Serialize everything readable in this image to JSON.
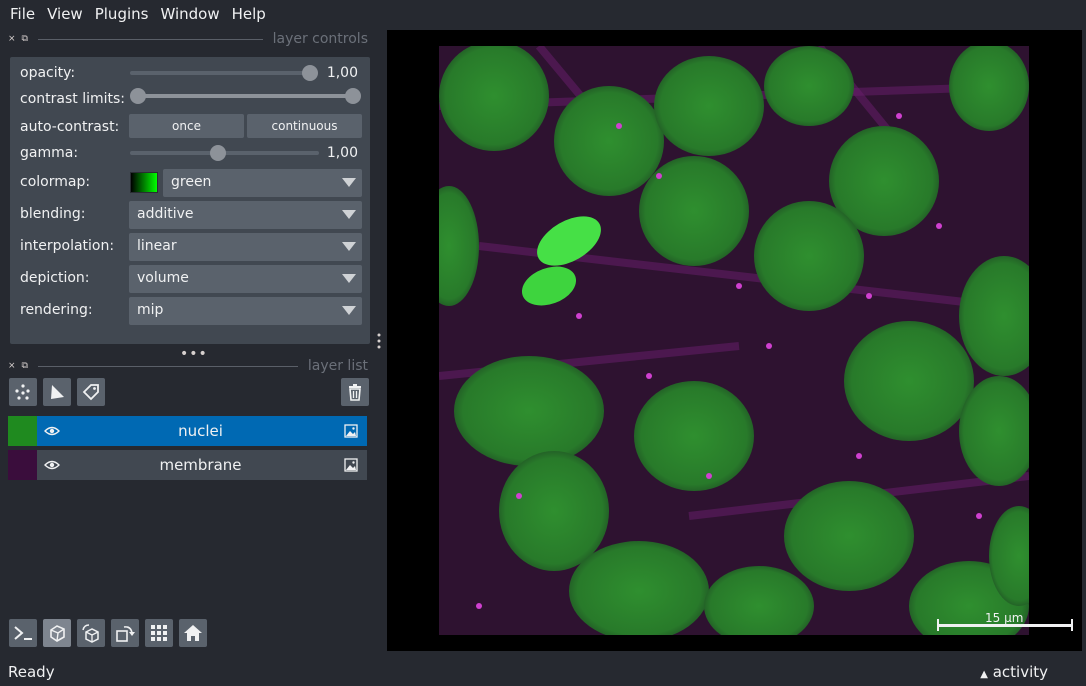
{
  "menu": [
    "File",
    "View",
    "Plugins",
    "Window",
    "Help"
  ],
  "layer_controls": {
    "title": "layer controls",
    "opacity": {
      "label": "opacity:",
      "value": "1,00",
      "level": 1.0
    },
    "contrast": {
      "label": "contrast limits:",
      "low": 0.0,
      "high": 1.0
    },
    "auto_contrast": {
      "label": "auto-contrast:",
      "once": "once",
      "continuous": "continuous"
    },
    "gamma": {
      "label": "gamma:",
      "value": "1,00",
      "level": 0.44
    },
    "colormap": {
      "label": "colormap:",
      "value": "green"
    },
    "blending": {
      "label": "blending:",
      "value": "additive"
    },
    "interpolation": {
      "label": "interpolation:",
      "value": "linear"
    },
    "depiction": {
      "label": "depiction:",
      "value": "volume"
    },
    "rendering": {
      "label": "rendering:",
      "value": "mip"
    }
  },
  "layer_list": {
    "title": "layer list",
    "layers": [
      {
        "name": "nuclei",
        "selected": true,
        "thumb_color": "#1f8a1f"
      },
      {
        "name": "membrane",
        "selected": false,
        "thumb_color": "#3a0d3c"
      }
    ]
  },
  "scale_bar": {
    "label": "15 µm"
  },
  "status": {
    "text": "Ready",
    "activity": "activity"
  },
  "colors": {
    "accent": "#0069b3",
    "panel": "#414851",
    "background": "#262930"
  }
}
